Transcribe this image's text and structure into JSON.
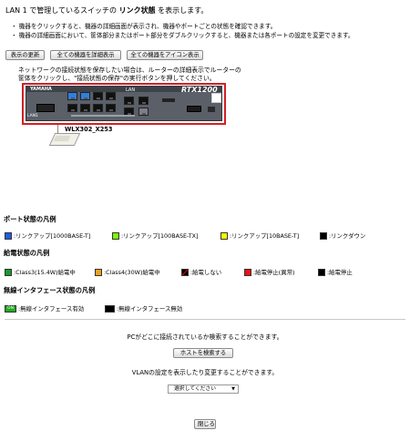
{
  "header": {
    "title_prefix": "LAN 1 で管理しているスイッチの",
    "title_strong": "リンク状態",
    "title_suffix": "を表示します。",
    "bullets": [
      "・ 機器をクリックすると、機器の詳細画面が表示され、機器やポートごとの状態を確認できます。",
      "・ 機器の詳細画面において、筐体部分またはポート部分をダブルクリックすると、機器または各ポートの設定を変更できます。"
    ]
  },
  "toolbar": {
    "refresh_label": "表示の更新",
    "detail_all_label": "全ての機器を詳細表示",
    "icon_all_label": "全ての機器をアイコン表示"
  },
  "notice": {
    "line1": "ネットワークの接続状態を保存したい場合は、ルーターの詳細表示でルーターの",
    "line2": "筐体をクリックし、\"接続状態の保存\"の実行ボタンを押してください。"
  },
  "device": {
    "brand": "YAMAHA",
    "model": "RTX1200",
    "small_label": "LAN",
    "lan_label": "LAN1",
    "ap_name": "WLX302_X253"
  },
  "port_legend": {
    "title": "ポート状態の凡例",
    "items": [
      {
        "label": ":リンクアップ[1000BASE-T]",
        "color": "#1f5fe0"
      },
      {
        "label": ":リンクアップ[100BASE-TX]",
        "color": "#7cfc00"
      },
      {
        "label": ":リンクアップ[10BASE-T]",
        "color": "#ffff00"
      },
      {
        "label": ":リンクダウン",
        "color": "#000000"
      }
    ]
  },
  "power_legend": {
    "title": "給電状態の凡例",
    "items": [
      {
        "label": ":Class3(15.4W)給電中",
        "color": "#1a9a2a"
      },
      {
        "label": ":Class4(30W)給電中",
        "color": "#f0a020"
      },
      {
        "label": ":給電しない",
        "color": "#000000"
      },
      {
        "label": ":給電停止(異常)",
        "color": "#ee1111"
      },
      {
        "label": ":給電停止",
        "color": "#000000"
      }
    ]
  },
  "wireless_legend": {
    "title": "無線インタフェース状態の凡例",
    "items": [
      {
        "label": ":無線インタフェース有効",
        "badge": "ON",
        "color": "#22aa22"
      },
      {
        "label": ":無線インタフェース無効",
        "color": "#000000"
      }
    ]
  },
  "footer": {
    "host_text": "PCがどこに接続されているか検索することができます。",
    "host_button": "ホストを検索する",
    "vlan_text": "VLANの設定を表示したり変更することができます。",
    "vlan_select": "選択してください",
    "close_button": "閉じる"
  }
}
